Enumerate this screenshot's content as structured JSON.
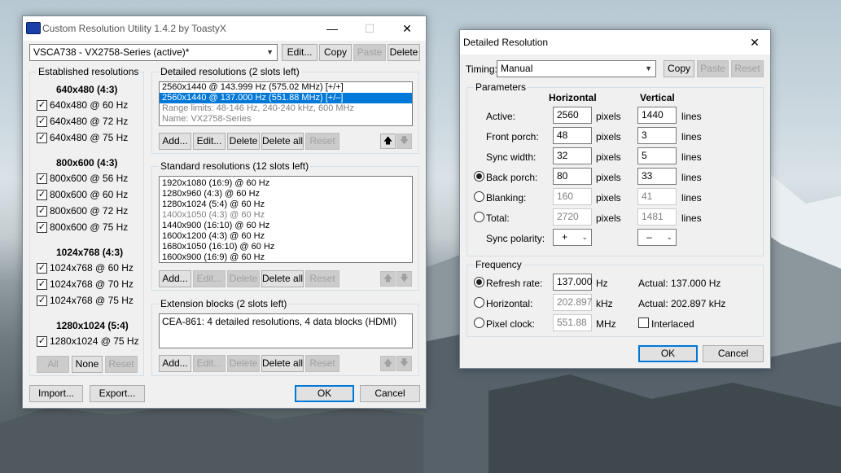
{
  "main_window": {
    "title": "Custom Resolution Utility 1.4.2 by ToastyX",
    "monitor_select": "VSCA738 - VX2758-Series (active)*",
    "edit_btn": "Edit...",
    "copy_btn": "Copy",
    "paste_btn": "Paste",
    "delete_btn": "Delete",
    "established": {
      "label": "Established resolutions",
      "groups": [
        {
          "header": "640x480 (4:3)",
          "items": [
            "640x480 @ 60 Hz",
            "640x480 @ 72 Hz",
            "640x480 @ 75 Hz"
          ]
        },
        {
          "header": "800x600 (4:3)",
          "items": [
            "800x600 @ 56 Hz",
            "800x600 @ 60 Hz",
            "800x600 @ 72 Hz",
            "800x600 @ 75 Hz"
          ]
        },
        {
          "header": "1024x768 (4:3)",
          "items": [
            "1024x768 @ 60 Hz",
            "1024x768 @ 70 Hz",
            "1024x768 @ 75 Hz"
          ]
        },
        {
          "header": "1280x1024 (5:4)",
          "items": [
            "1280x1024 @ 75 Hz"
          ]
        }
      ],
      "all_btn": "All",
      "none_btn": "None",
      "reset_btn": "Reset"
    },
    "detailed": {
      "label": "Detailed resolutions (2 slots left)",
      "items": [
        "2560x1440 @ 143.999 Hz (575.02 MHz) [+/+]",
        "2560x1440 @ 137.000 Hz (551.88 MHz) [+/–]"
      ],
      "info": [
        "Range limits: 48-146 Hz, 240-240 kHz, 600 MHz",
        "Name: VX2758-Series"
      ],
      "add": "Add...",
      "edit": "Edit...",
      "delete": "Delete",
      "delete_all": "Delete all",
      "reset": "Reset"
    },
    "standard": {
      "label": "Standard resolutions (12 slots left)",
      "items": [
        "1920x1080 (16:9) @ 60 Hz",
        "1280x960 (4:3) @ 60 Hz",
        "1280x1024 (5:4) @ 60 Hz",
        "1400x1050 (4:3) @ 60 Hz",
        "1440x900 (16:10) @ 60 Hz",
        "1600x1200 (4:3) @ 60 Hz",
        "1680x1050 (16:10) @ 60 Hz",
        "1600x900 (16:9) @ 60 Hz"
      ],
      "add": "Add...",
      "edit": "Edit...",
      "delete": "Delete",
      "delete_all": "Delete all",
      "reset": "Reset"
    },
    "extension": {
      "label": "Extension blocks (2 slots left)",
      "items": [
        "CEA-861: 4 detailed resolutions, 4 data blocks (HDMI)"
      ],
      "add": "Add...",
      "edit": "Edit...",
      "delete": "Delete",
      "delete_all": "Delete all",
      "reset": "Reset"
    },
    "import_btn": "Import...",
    "export_btn": "Export...",
    "ok_btn": "OK",
    "cancel_btn": "Cancel"
  },
  "detail_dialog": {
    "title": "Detailed Resolution",
    "timing_label": "Timing:",
    "timing_value": "Manual",
    "copy_btn": "Copy",
    "paste_btn": "Paste",
    "reset_btn": "Reset",
    "params_label": "Parameters",
    "horizontal": "Horizontal",
    "vertical": "Vertical",
    "pixels": "pixels",
    "lines": "lines",
    "rows": [
      {
        "label": "Active:",
        "h": "2560",
        "v": "1440"
      },
      {
        "label": "Front porch:",
        "h": "48",
        "v": "3"
      },
      {
        "label": "Sync width:",
        "h": "32",
        "v": "5"
      },
      {
        "label": "Back porch:",
        "h": "80",
        "v": "33"
      },
      {
        "label": "Blanking:",
        "h": "160",
        "v": "41"
      },
      {
        "label": "Total:",
        "h": "2720",
        "v": "1481"
      }
    ],
    "sync_polarity_label": "Sync polarity:",
    "h_polarity": "+",
    "v_polarity": "–",
    "frequency_label": "Frequency",
    "refresh_label": "Refresh rate:",
    "refresh_value": "137.000",
    "refresh_unit": "Hz",
    "refresh_actual": "Actual: 137.000 Hz",
    "horizontal_label": "Horizontal:",
    "horizontal_value": "202.897",
    "horizontal_unit": "kHz",
    "horizontal_actual": "Actual: 202.897 kHz",
    "pixel_clock_label": "Pixel clock:",
    "pixel_clock_value": "551.88",
    "pixel_clock_unit": "MHz",
    "interlaced_label": "Interlaced",
    "ok_btn": "OK",
    "cancel_btn": "Cancel"
  }
}
